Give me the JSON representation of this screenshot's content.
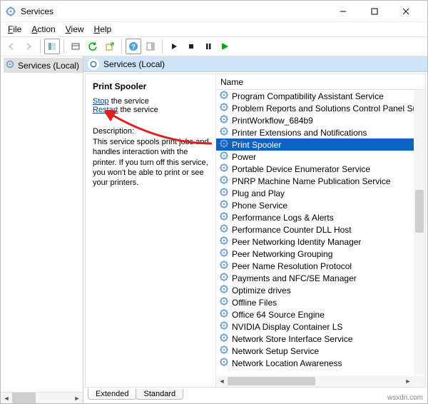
{
  "titlebar": {
    "title": "Services"
  },
  "menu": {
    "file": "File",
    "action": "Action",
    "view": "View",
    "help": "Help"
  },
  "tree": {
    "root": "Services (Local)"
  },
  "header": {
    "label": "Services (Local)"
  },
  "detail": {
    "title": "Print Spooler",
    "stop_link": "Stop",
    "stop_suffix": " the service",
    "restart_link": "Restart",
    "restart_suffix": " the service",
    "desc_label": "Description:",
    "desc_text": "This service spools print jobs and handles interaction with the printer. If you turn off this service, you won't be able to print or see your printers."
  },
  "columns": {
    "name": "Name"
  },
  "services": [
    {
      "name": "Program Compatibility Assistant Service",
      "selected": false
    },
    {
      "name": "Problem Reports and Solutions Control Panel Support",
      "selected": false
    },
    {
      "name": "PrintWorkflow_684b9",
      "selected": false
    },
    {
      "name": "Printer Extensions and Notifications",
      "selected": false
    },
    {
      "name": "Print Spooler",
      "selected": true
    },
    {
      "name": "Power",
      "selected": false
    },
    {
      "name": "Portable Device Enumerator Service",
      "selected": false
    },
    {
      "name": "PNRP Machine Name Publication Service",
      "selected": false
    },
    {
      "name": "Plug and Play",
      "selected": false
    },
    {
      "name": "Phone Service",
      "selected": false
    },
    {
      "name": "Performance Logs & Alerts",
      "selected": false
    },
    {
      "name": "Performance Counter DLL Host",
      "selected": false
    },
    {
      "name": "Peer Networking Identity Manager",
      "selected": false
    },
    {
      "name": "Peer Networking Grouping",
      "selected": false
    },
    {
      "name": "Peer Name Resolution Protocol",
      "selected": false
    },
    {
      "name": "Payments and NFC/SE Manager",
      "selected": false
    },
    {
      "name": "Optimize drives",
      "selected": false
    },
    {
      "name": "Offline Files",
      "selected": false
    },
    {
      "name": "Office 64 Source Engine",
      "selected": false
    },
    {
      "name": "NVIDIA Display Container LS",
      "selected": false
    },
    {
      "name": "Network Store Interface Service",
      "selected": false
    },
    {
      "name": "Network Setup Service",
      "selected": false
    },
    {
      "name": "Network Location Awareness",
      "selected": false
    }
  ],
  "tabs": {
    "extended": "Extended",
    "standard": "Standard"
  },
  "credit": "wsxdn.com"
}
